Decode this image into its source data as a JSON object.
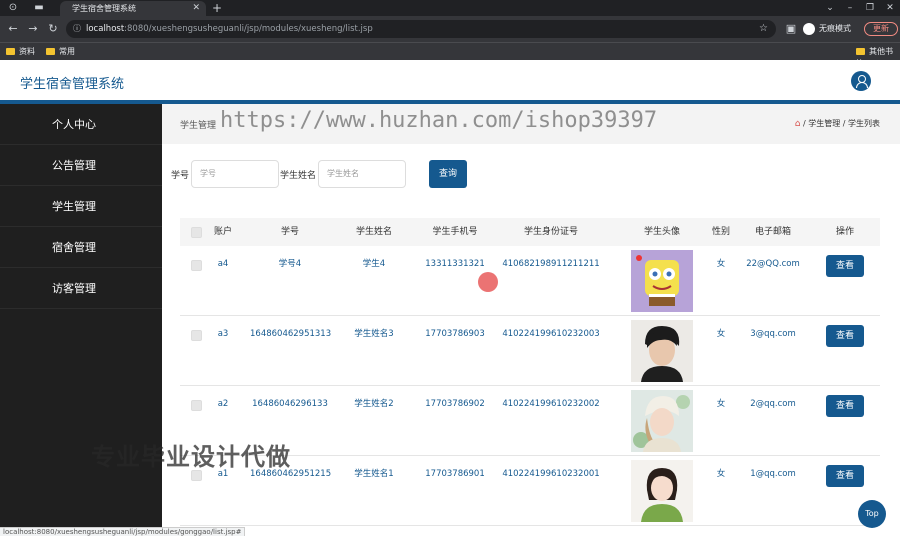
{
  "browser": {
    "tab_title": "学生宿舍管理系统",
    "url_host": "localhost",
    "url_rest": ":8080/xueshengsushe­guanli/jsp/modules/xuesheng/list.jsp",
    "incognito_label": "无痕模式",
    "update_label": "更新",
    "bookmarks": [
      "资料",
      "常用",
      "其他书签"
    ],
    "status_url": "localhost:8080/xueshengsusheguanli/jsp/modules/gonggao/list.jsp#"
  },
  "app": {
    "title": "学生宿舍管理系统"
  },
  "sidebar": {
    "items": [
      {
        "label": "个人中心"
      },
      {
        "label": "公告管理"
      },
      {
        "label": "学生管理"
      },
      {
        "label": "宿舍管理"
      },
      {
        "label": "访客管理"
      }
    ]
  },
  "breadcrumb": {
    "left": "学生管理",
    "right": "/ 学生管理 / 学生列表"
  },
  "watermark": "https://www.huzhan.com/ishop39397",
  "overlay_text": "专业毕业设计代做",
  "search": {
    "xuehao_label": "学号",
    "xuehao_placeholder": "学号",
    "name_label": "学生姓名",
    "name_placeholder": "学生姓名",
    "button": "查询"
  },
  "table": {
    "headers": [
      "账户",
      "学号",
      "学生姓名",
      "学生手机号",
      "学生身份证号",
      "学生头像",
      "性别",
      "电子邮箱",
      "操作"
    ],
    "rows": [
      {
        "account": "a4",
        "xuehao": "学号4",
        "name": "学生4",
        "phone": "13311331321",
        "idcard": "410682198911211211",
        "gender": "女",
        "email": "22@QQ.com",
        "action": "查看",
        "avatar": "spongebob"
      },
      {
        "account": "a3",
        "xuehao": "164860462951313",
        "name": "学生姓名3",
        "phone": "17703786903",
        "idcard": "410224199610232003",
        "gender": "女",
        "email": "3@qq.com",
        "action": "查看",
        "avatar": "boy"
      },
      {
        "account": "a2",
        "xuehao": "16486046296133",
        "name": "学生姓名2",
        "phone": "17703786902",
        "idcard": "410224199610232002",
        "gender": "女",
        "email": "2@qq.com",
        "action": "查看",
        "avatar": "girl-hat"
      },
      {
        "account": "a1",
        "xuehao": "164860462951215",
        "name": "学生姓名1",
        "phone": "17703786901",
        "idcard": "410224199610232001",
        "gender": "女",
        "email": "1@qq.com",
        "action": "查看",
        "avatar": "girl-green"
      }
    ]
  },
  "top_button": "Top",
  "colors": {
    "primary": "#15598f",
    "sidebar_bg": "#1f1f1f",
    "browser_dark": "#202124"
  }
}
